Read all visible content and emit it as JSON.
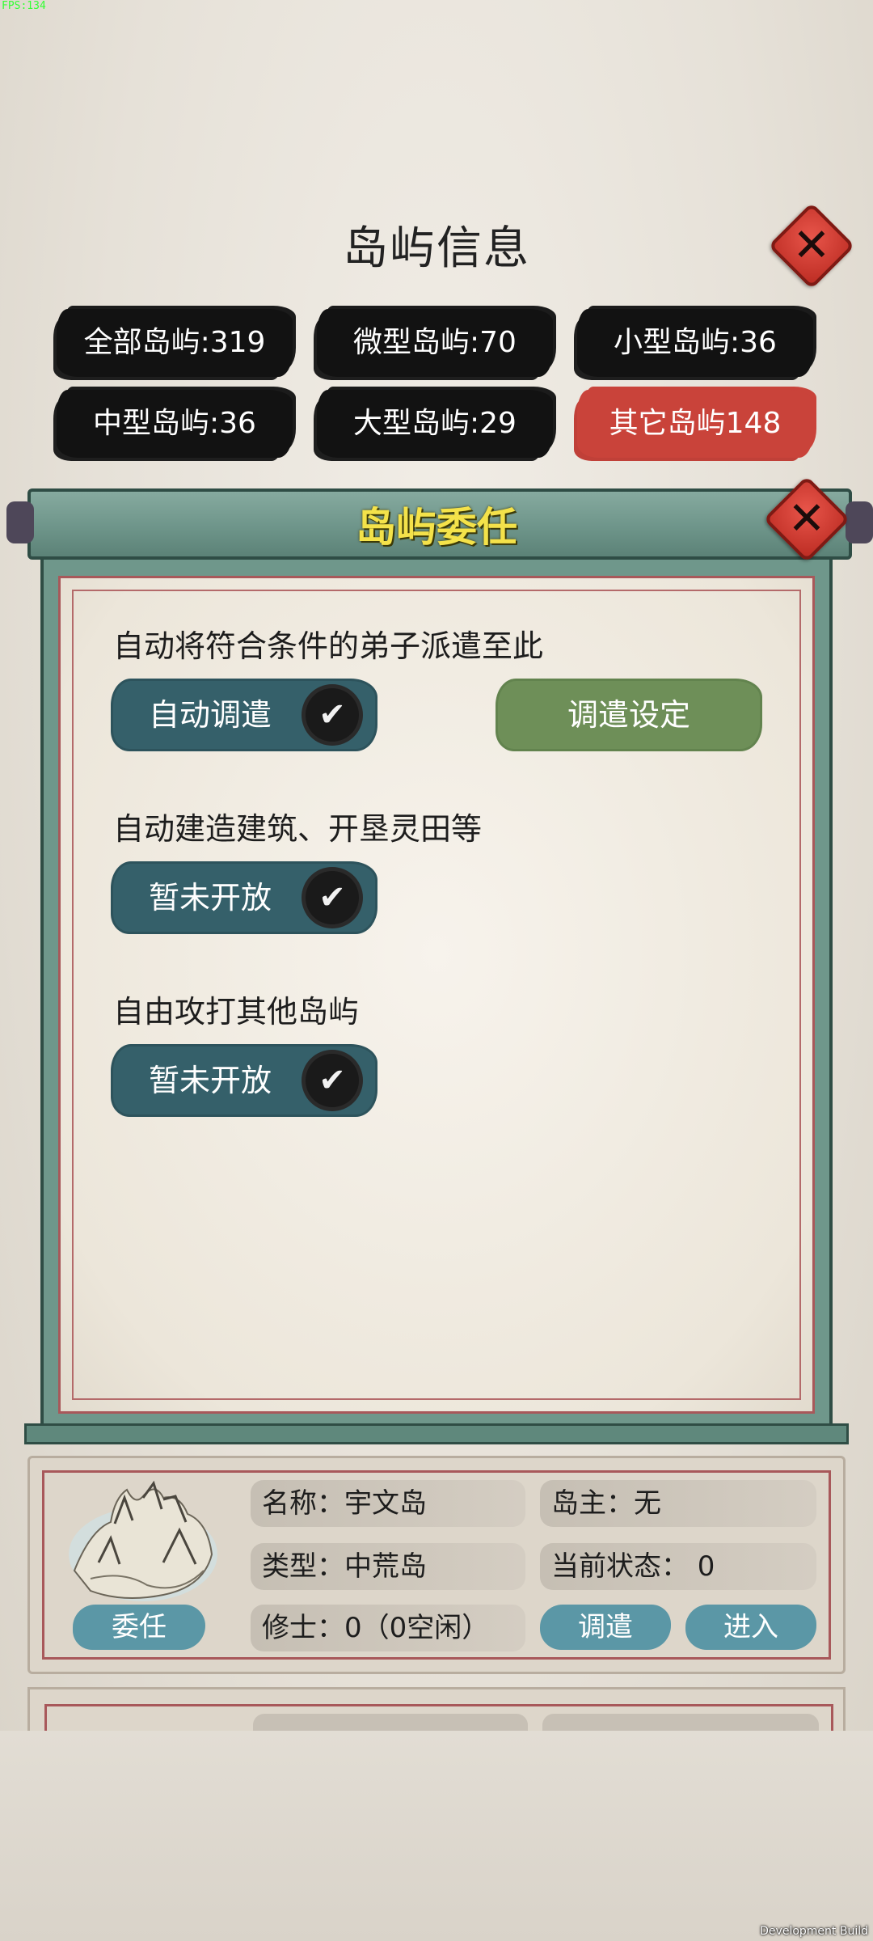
{
  "debug": {
    "fps": "FPS:134",
    "build": "Development Build"
  },
  "header": {
    "title": "岛屿信息"
  },
  "filters": [
    {
      "label": "全部岛屿:319",
      "active": false
    },
    {
      "label": "微型岛屿:70",
      "active": false
    },
    {
      "label": "小型岛屿:36",
      "active": false
    },
    {
      "label": "中型岛屿:36",
      "active": false
    },
    {
      "label": "大型岛屿:29",
      "active": false
    },
    {
      "label": "其它岛屿148",
      "active": true
    }
  ],
  "modal": {
    "title": "岛屿委任",
    "options": [
      {
        "label": "自动将符合条件的弟子派遣至此",
        "toggle": "自动调遣",
        "checked": true,
        "extra_button": "调遣设定"
      },
      {
        "label": "自动建造建筑、开垦灵田等",
        "toggle": "暂未开放",
        "checked": true
      },
      {
        "label": "自由攻打其他岛屿",
        "toggle": "暂未开放",
        "checked": true
      }
    ]
  },
  "island": {
    "appoint": "委任",
    "name": "名称：宇文岛",
    "owner": "岛主：无",
    "type": "类型：中荒岛",
    "status": "当前状态：  0",
    "cultivators": "修士：0（0空闲）",
    "dispatch": "调遣",
    "enter": "进入"
  },
  "icons": {
    "close": "close-icon",
    "check": "checkmark-icon",
    "island": "island-map-icon"
  },
  "colors": {
    "active_chip": "#c9433a",
    "modal_title": "#f4e24a",
    "teal": "#35606a",
    "green": "#6e8f58",
    "pill": "#5b97a6"
  }
}
